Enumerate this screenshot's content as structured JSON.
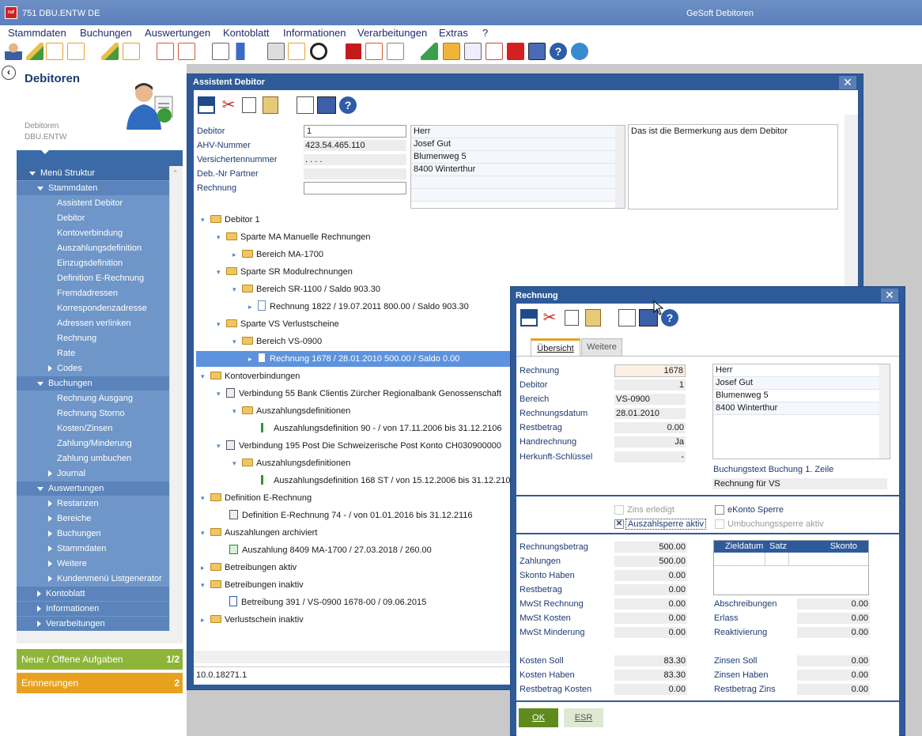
{
  "window": {
    "title_left": "751  DBU.ENTW  DE",
    "title_center": "GeSoft Debitoren",
    "app_icon": "ruf-logo-icon"
  },
  "menu": [
    "Stammdaten",
    "Buchungen",
    "Auswertungen",
    "Kontoblatt",
    "Informationen",
    "Verarbeitungen",
    "Extras",
    "?"
  ],
  "left": {
    "title": "Debitoren",
    "sub1": "Debitoren",
    "sub2": "DBU.ENTW",
    "tree": [
      {
        "label": "Menü Struktur",
        "level": 0,
        "open": true
      },
      {
        "label": "Stammdaten",
        "level": 1,
        "open": true
      },
      {
        "label": "Assistent Debitor",
        "level": 2
      },
      {
        "label": "Debitor",
        "level": 2
      },
      {
        "label": "Kontoverbindung",
        "level": 2
      },
      {
        "label": "Auszahlungsdefinition",
        "level": 2
      },
      {
        "label": "Einzugsdefinition",
        "level": 2
      },
      {
        "label": "Definition E-Rechnung",
        "level": 2
      },
      {
        "label": "Fremdadressen",
        "level": 2
      },
      {
        "label": "Korrespondenzadresse",
        "level": 2
      },
      {
        "label": "Adressen verlinken",
        "level": 2
      },
      {
        "label": "Rechnung",
        "level": 2
      },
      {
        "label": "Rate",
        "level": 2
      },
      {
        "label": "Codes",
        "level": 2,
        "closed": true
      },
      {
        "label": "Buchungen",
        "level": 1,
        "open": true
      },
      {
        "label": "Rechnung Ausgang",
        "level": 2
      },
      {
        "label": "Rechnung Storno",
        "level": 2
      },
      {
        "label": "Kosten/Zinsen",
        "level": 2
      },
      {
        "label": "Zahlung/Minderung",
        "level": 2
      },
      {
        "label": "Zahlung umbuchen",
        "level": 2
      },
      {
        "label": "Journal",
        "level": 2,
        "closed": true
      },
      {
        "label": "Auswertungen",
        "level": 1,
        "open": true
      },
      {
        "label": "Restanzen",
        "level": 2,
        "closed": true
      },
      {
        "label": "Bereiche",
        "level": 2,
        "closed": true
      },
      {
        "label": "Buchungen",
        "level": 2,
        "closed": true
      },
      {
        "label": "Stammdaten",
        "level": 2,
        "closed": true
      },
      {
        "label": "Weitere",
        "level": 2,
        "closed": true
      },
      {
        "label": "Kundenmenü Listgenerator",
        "level": 2,
        "closed": true
      },
      {
        "label": "Kontoblatt",
        "level": 1,
        "closed": true
      },
      {
        "label": "Informationen",
        "level": 1,
        "closed": true
      },
      {
        "label": "Verarbeitungen",
        "level": 1,
        "closed": true
      }
    ],
    "tasks": [
      {
        "label": "Neue / Offene Aufgaben",
        "count": "1/2"
      },
      {
        "label": "Erinnerungen",
        "count": "2"
      }
    ]
  },
  "assistant": {
    "title": "Assistent Debitor",
    "fields": [
      {
        "label": "Debitor",
        "value": "1"
      },
      {
        "label": "AHV-Nummer",
        "value": "423.54.465.110"
      },
      {
        "label": "Versichertennummer",
        "value": ".  .  .  ."
      },
      {
        "label": "Deb.-Nr Partner",
        "value": ""
      },
      {
        "label": "Rechnung",
        "value": ""
      }
    ],
    "address": [
      "Herr",
      "Josef Gut",
      "Blumenweg 5",
      "8400 Winterthur"
    ],
    "remark": "Das ist die Bermerkung aus dem Debitor",
    "tree": [
      "Debitor 1",
      "Sparte MA Manuelle Rechnungen",
      "Bereich MA-1700",
      "Sparte SR Modulrechnungen",
      "Bereich SR-1100 / Saldo 903.30",
      "Rechnung 1822 / 19.07.2011  800.00 / Saldo 903.30",
      "Sparte VS Verlustscheine",
      "Bereich VS-0900",
      "Rechnung 1678 / 28.01.2010  500.00 / Saldo 0.00",
      "Kontoverbindungen",
      "Verbindung 55  Bank  Clientis Zürcher Regionalbank Genossenschaft",
      "Auszahlungsdefinitionen",
      "Auszahlungsdefinition 90  - / von 17.11.2006 bis 31.12.2106",
      "Verbindung 195  Post  Die Schweizerische Post  Konto CH030900000",
      "Auszahlungsdefinitionen",
      "Auszahlungsdefinition 168  ST / von 15.12.2006 bis 31.12.210",
      "Definition E-Rechnung",
      "Definition E-Rechnung 74  - / von 01.01.2016 bis 31.12.2116",
      "Auszahlungen archiviert",
      "Auszahlung 8409  MA-1700 / 27.03.2018 / 260.00",
      "Betreibungen aktiv",
      "Betreibungen inaktiv",
      "Betreibung 391 / VS-0900  1678-00 / 09.06.2015",
      "Verlustschein inaktiv"
    ],
    "status": "10.0.18271.1"
  },
  "rechnung": {
    "title": "Rechnung",
    "tabs": [
      "Übersicht",
      "Weitere"
    ],
    "fields": [
      {
        "label": "Rechnung",
        "value": "1678"
      },
      {
        "label": "Debitor",
        "value": "1"
      },
      {
        "label": "Bereich",
        "value": "VS-0900"
      },
      {
        "label": "Rechnungsdatum",
        "value": "28.01.2010"
      },
      {
        "label": "Restbetrag",
        "value": "0.00"
      },
      {
        "label": "Handrechnung",
        "value": "Ja"
      },
      {
        "label": "Herkunft-Schlüssel",
        "value": "-"
      }
    ],
    "address": [
      "Herr",
      "Josef Gut",
      "Blumenweg 5",
      "8400 Winterthur"
    ],
    "buchungstext_label": "Buchungstext Buchung 1. Zeile",
    "buchungstext": "Rechnung für VS",
    "checks": [
      {
        "label": "Zins erledigt",
        "checked": false,
        "enabled": false
      },
      {
        "label": "eKonto Sperre",
        "checked": false,
        "enabled": true
      },
      {
        "label": "Auszahlsperre aktiv",
        "checked": true,
        "enabled": true
      },
      {
        "label": "Umbuchungssperre aktiv",
        "checked": false,
        "enabled": false
      }
    ],
    "amounts_left": [
      {
        "label": "Rechnungsbetrag",
        "value": "500.00"
      },
      {
        "label": "Zahlungen",
        "value": "500.00"
      },
      {
        "label": "Skonto Haben",
        "value": "0.00"
      },
      {
        "label": "Restbetrag",
        "value": "0.00"
      },
      {
        "label": "MwSt Rechnung",
        "value": "0.00"
      },
      {
        "label": "MwSt Kosten",
        "value": "0.00"
      },
      {
        "label": "MwSt Minderung",
        "value": "0.00"
      }
    ],
    "skonto_headers": [
      "Zieldatum",
      "Satz",
      "Skonto"
    ],
    "amounts_right": [
      {
        "label": "Abschreibungen",
        "value": "0.00"
      },
      {
        "label": "Erlass",
        "value": "0.00"
      },
      {
        "label": "Reaktivierung",
        "value": "0.00"
      }
    ],
    "costs_left": [
      {
        "label": "Kosten Soll",
        "value": "83.30"
      },
      {
        "label": "Kosten Haben",
        "value": "83.30"
      },
      {
        "label": "Restbetrag Kosten",
        "value": "0.00"
      }
    ],
    "costs_right": [
      {
        "label": "Zinsen Soll",
        "value": "0.00"
      },
      {
        "label": "Zinsen Haben",
        "value": "0.00"
      },
      {
        "label": "Restbetrag Zins",
        "value": "0.00"
      }
    ],
    "buttons": {
      "ok": "OK",
      "esr": "ESR"
    }
  }
}
